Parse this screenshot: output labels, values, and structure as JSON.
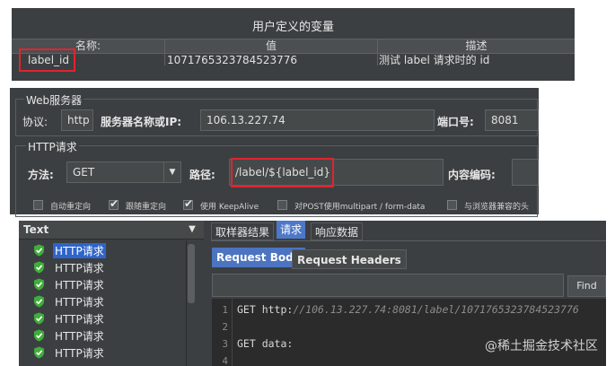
{
  "user_vars": {
    "title": "用户定义的变量",
    "columns": [
      "名称:",
      "值",
      "描述"
    ],
    "row": {
      "name": "label_id",
      "value": "1071765323784523776",
      "desc": "测试 label 请求时的 id"
    },
    "highlight_color": "#e0242f"
  },
  "http_sampler": {
    "web_server_title": "Web服务器",
    "protocol_label": "协议:",
    "protocol_value": "http",
    "server_label": "服务器名称或IP:",
    "server_value": "106.13.227.74",
    "port_label": "端口号:",
    "port_value": "8081",
    "http_request_title": "HTTP请求",
    "method_label": "方法:",
    "method_value": "GET",
    "path_label": "路径:",
    "path_value": "/label/${label_id}",
    "encoding_label": "内容编码:",
    "options": [
      {
        "label": "自动重定向",
        "checked": false
      },
      {
        "label": "跟随重定向",
        "checked": true
      },
      {
        "label": "使用 KeepAlive",
        "checked": true
      },
      {
        "label": "对POST使用multipart / form-data",
        "checked": false
      },
      {
        "label": "与浏览器兼容的头",
        "checked": false
      }
    ]
  },
  "tree": {
    "header": "Text",
    "items": [
      "HTTP请求",
      "HTTP请求",
      "HTTP请求",
      "HTTP请求",
      "HTTP请求",
      "HTTP请求",
      "HTTP请求"
    ],
    "selected_index": 0,
    "success_color": "#3fae3a"
  },
  "result_tabs": [
    "取样器结果",
    "请求",
    "响应数据"
  ],
  "result_tab_active": 1,
  "request_subtabs": [
    "Request Body",
    "Request Headers"
  ],
  "find_button": "Find",
  "editor": {
    "lines": [
      {
        "num": "1",
        "prefix": "GET http:",
        "url": "//106.13.227.74:8081/label/1071765323784523776"
      },
      {
        "num": "2",
        "prefix": "",
        "url": ""
      },
      {
        "num": "3",
        "prefix": "GET data:",
        "url": ""
      },
      {
        "num": "4",
        "prefix": "",
        "url": ""
      }
    ]
  },
  "watermark": "@稀土掘金技术社区"
}
